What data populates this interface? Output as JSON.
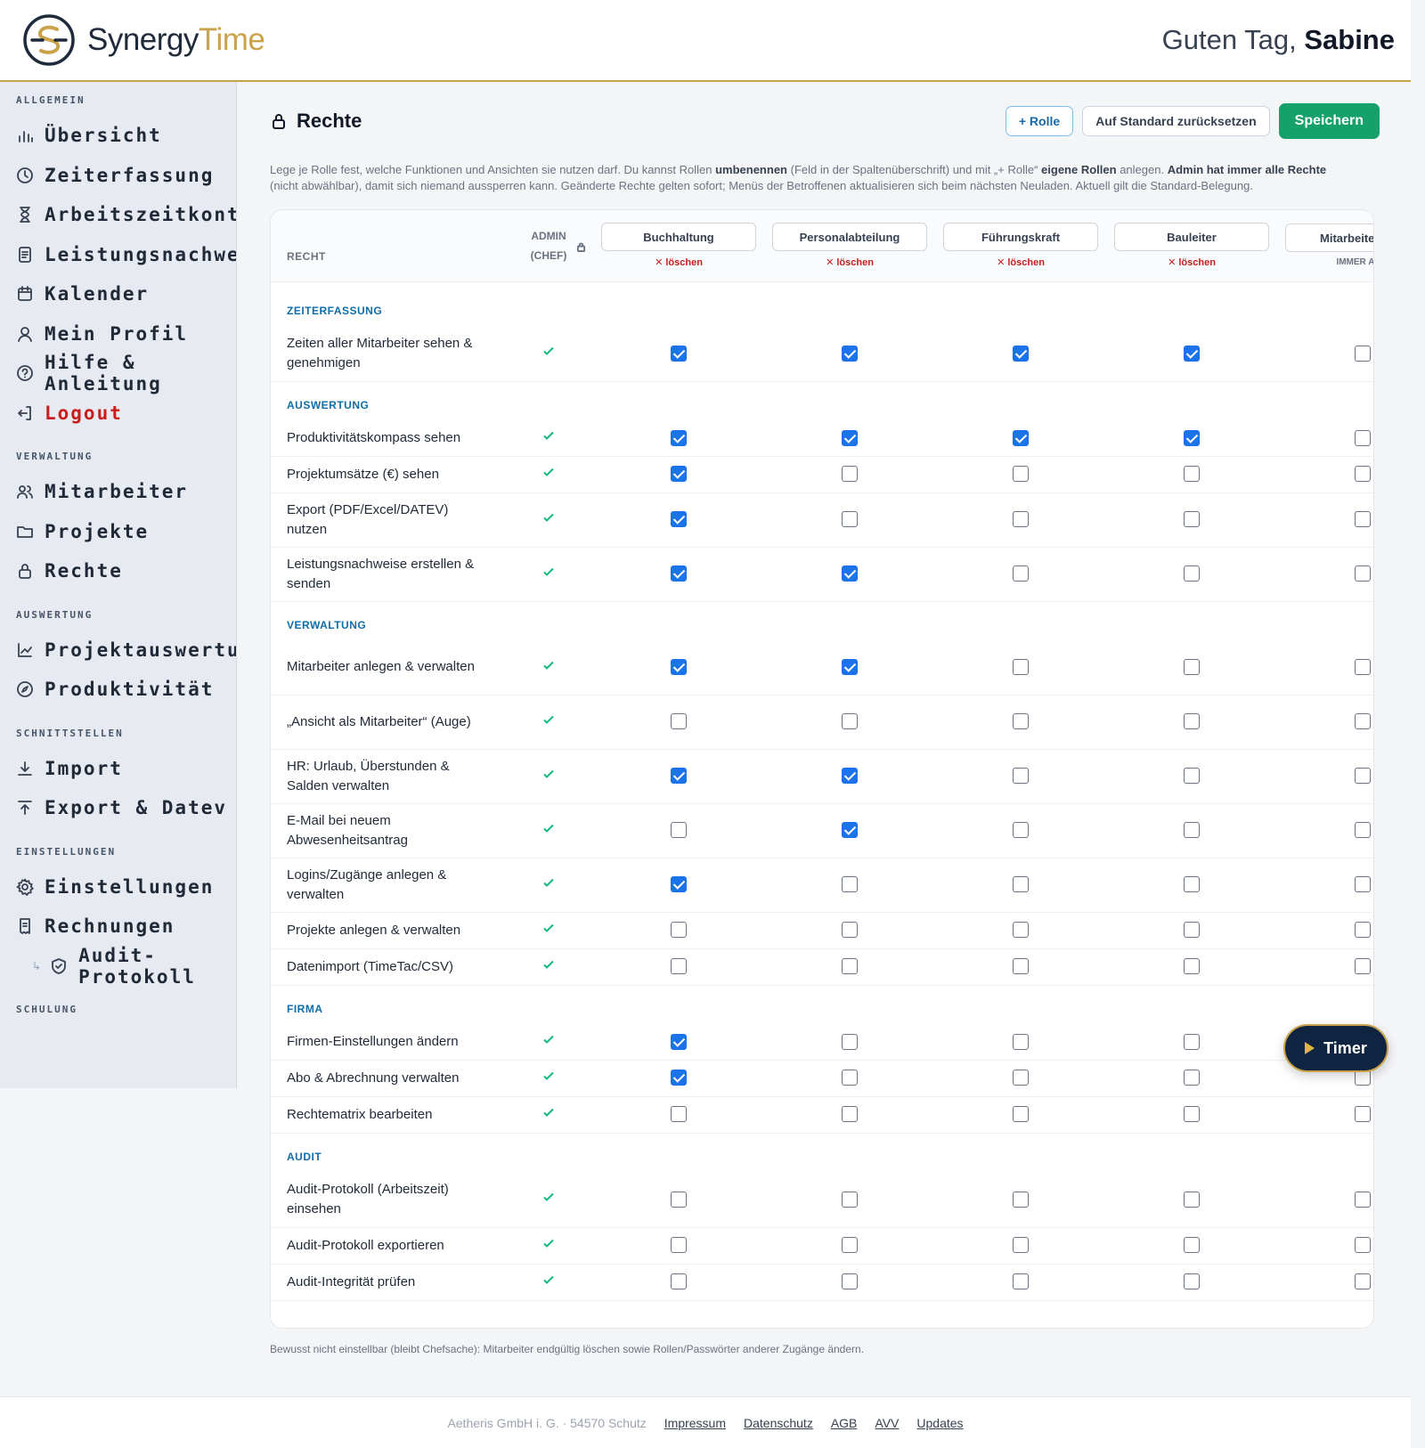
{
  "brand": {
    "name_part1": "Synergy",
    "name_part2": "Time"
  },
  "greeting": {
    "prefix": "Guten Tag,",
    "name": "Sabine"
  },
  "sidebar": {
    "sections": [
      {
        "title": "ALLGEMEIN",
        "items": [
          {
            "label": "Übersicht",
            "icon": "bar-chart-icon"
          },
          {
            "label": "Zeiterfassung",
            "icon": "clock-icon"
          },
          {
            "label": "Arbeitszeitkonto",
            "icon": "hourglass-icon"
          },
          {
            "label": "Leistungsnachweis",
            "icon": "document-icon"
          },
          {
            "label": "Kalender",
            "icon": "calendar-icon"
          },
          {
            "label": "Mein Profil",
            "icon": "user-icon"
          },
          {
            "label": "Hilfe & Anleitung",
            "icon": "help-icon"
          },
          {
            "label": "Logout",
            "icon": "logout-icon"
          }
        ]
      },
      {
        "title": "VERWALTUNG",
        "items": [
          {
            "label": "Mitarbeiter",
            "icon": "users-icon"
          },
          {
            "label": "Projekte",
            "icon": "folder-icon"
          },
          {
            "label": "Rechte",
            "icon": "lock-icon"
          }
        ]
      },
      {
        "title": "AUSWERTUNG",
        "items": [
          {
            "label": "Projektauswertung",
            "icon": "line-chart-icon"
          },
          {
            "label": "Produktivität",
            "icon": "compass-icon"
          }
        ]
      },
      {
        "title": "SCHNITTSTELLEN",
        "items": [
          {
            "label": "Import",
            "icon": "download-icon"
          },
          {
            "label": "Export & Datev",
            "icon": "upload-icon"
          }
        ]
      },
      {
        "title": "EINSTELLUNGEN",
        "items": [
          {
            "label": "Einstellungen",
            "icon": "gear-icon"
          },
          {
            "label": "Rechnungen",
            "icon": "receipt-icon"
          },
          {
            "label": "Audit-Protokoll",
            "icon": "shield-icon"
          }
        ]
      },
      {
        "title": "SCHULUNG",
        "items": []
      }
    ]
  },
  "page": {
    "title": "Rechte",
    "buttons": {
      "add_role": "+ Rolle",
      "reset": "Auf Standard zurücksetzen",
      "save": "Speichern"
    },
    "intro": {
      "t1": "Lege je Rolle fest, welche Funktionen und Ansichten sie nutzen darf. Du kannst Rollen ",
      "b1": "umbenennen",
      "t2": " (Feld in der Spaltenüberschrift) und mit „+ Rolle“ ",
      "b2": "eigene Rollen",
      "t3": " anlegen. ",
      "b3": "Admin hat immer alle Rechte",
      "t4": " (nicht abwählbar), damit sich niemand aussperren kann. Geänderte Rechte gelten sofort; Menüs der Betroffenen aktualisieren sich beim nächsten Neuladen. Aktuell gilt die Standard-Belegung."
    },
    "note": "Bewusst nicht einstellbar (bleibt Chefsache): Mitarbeiter endgültig löschen sowie Rollen/Passwörter anderer Zugänge ändern."
  },
  "table": {
    "col_recht": "RECHT",
    "col_admin_1": "ADMIN",
    "col_admin_2": "(CHEF)",
    "delete_label": "✕ löschen",
    "always_label": "IMMER AKTI",
    "roles": [
      "Buchhaltung",
      "Personalabteilung",
      "Führungskraft",
      "Bauleiter",
      "Mitarbeiter"
    ],
    "categories": [
      {
        "name": "ZEITERFASSUNG",
        "rows": [
          {
            "label": "Zeiten aller Mitarbeiter sehen & genehmigen",
            "values": [
              true,
              true,
              true,
              true,
              false
            ]
          }
        ]
      },
      {
        "name": "AUSWERTUNG",
        "rows": [
          {
            "label": "Produktivitätskompass sehen",
            "values": [
              true,
              true,
              true,
              true,
              false
            ]
          },
          {
            "label": "Projektumsätze (€) sehen",
            "values": [
              true,
              false,
              false,
              false,
              false
            ]
          },
          {
            "label": "Export (PDF/Excel/DATEV) nutzen",
            "values": [
              true,
              false,
              false,
              false,
              false
            ]
          },
          {
            "label": "Leistungsnachweise erstellen & senden",
            "values": [
              true,
              true,
              false,
              false,
              false
            ]
          }
        ]
      },
      {
        "name": "VERWALTUNG",
        "rows": [
          {
            "label": "Mitarbeiter anlegen & verwalten",
            "values": [
              true,
              true,
              false,
              false,
              false
            ]
          },
          {
            "label": "„Ansicht als Mitarbeiter“ (Auge)",
            "values": [
              false,
              false,
              false,
              false,
              false
            ]
          },
          {
            "label": "HR: Urlaub, Überstunden & Salden verwalten",
            "values": [
              true,
              true,
              false,
              false,
              false
            ]
          },
          {
            "label": "E-Mail bei neuem Abwesenheitsantrag",
            "values": [
              false,
              true,
              false,
              false,
              false
            ]
          },
          {
            "label": "Logins/Zugänge anlegen & verwalten",
            "values": [
              true,
              false,
              false,
              false,
              false
            ]
          },
          {
            "label": "Projekte anlegen & verwalten",
            "values": [
              false,
              false,
              false,
              false,
              false
            ]
          },
          {
            "label": "Datenimport (TimeTac/CSV)",
            "values": [
              false,
              false,
              false,
              false,
              false
            ]
          }
        ]
      },
      {
        "name": "FIRMA",
        "rows": [
          {
            "label": "Firmen-Einstellungen ändern",
            "values": [
              true,
              false,
              false,
              false,
              false
            ]
          },
          {
            "label": "Abo & Abrechnung verwalten",
            "values": [
              true,
              false,
              false,
              false,
              false
            ]
          },
          {
            "label": "Rechtematrix bearbeiten",
            "values": [
              false,
              false,
              false,
              false,
              false
            ]
          }
        ]
      },
      {
        "name": "AUDIT",
        "rows": [
          {
            "label": "Audit-Protokoll (Arbeitszeit) einsehen",
            "values": [
              false,
              false,
              false,
              false,
              false
            ]
          },
          {
            "label": "Audit-Protokoll exportieren",
            "values": [
              false,
              false,
              false,
              false,
              false
            ]
          },
          {
            "label": "Audit-Integrität prüfen",
            "values": [
              false,
              false,
              false,
              false,
              false
            ]
          }
        ]
      }
    ]
  },
  "timer": {
    "label": "Timer"
  },
  "footer": {
    "company": "Aetheris GmbH i. G. · 54570 Schutz",
    "links": [
      "Impressum",
      "Datenschutz",
      "AGB",
      "AVV",
      "Updates"
    ]
  }
}
